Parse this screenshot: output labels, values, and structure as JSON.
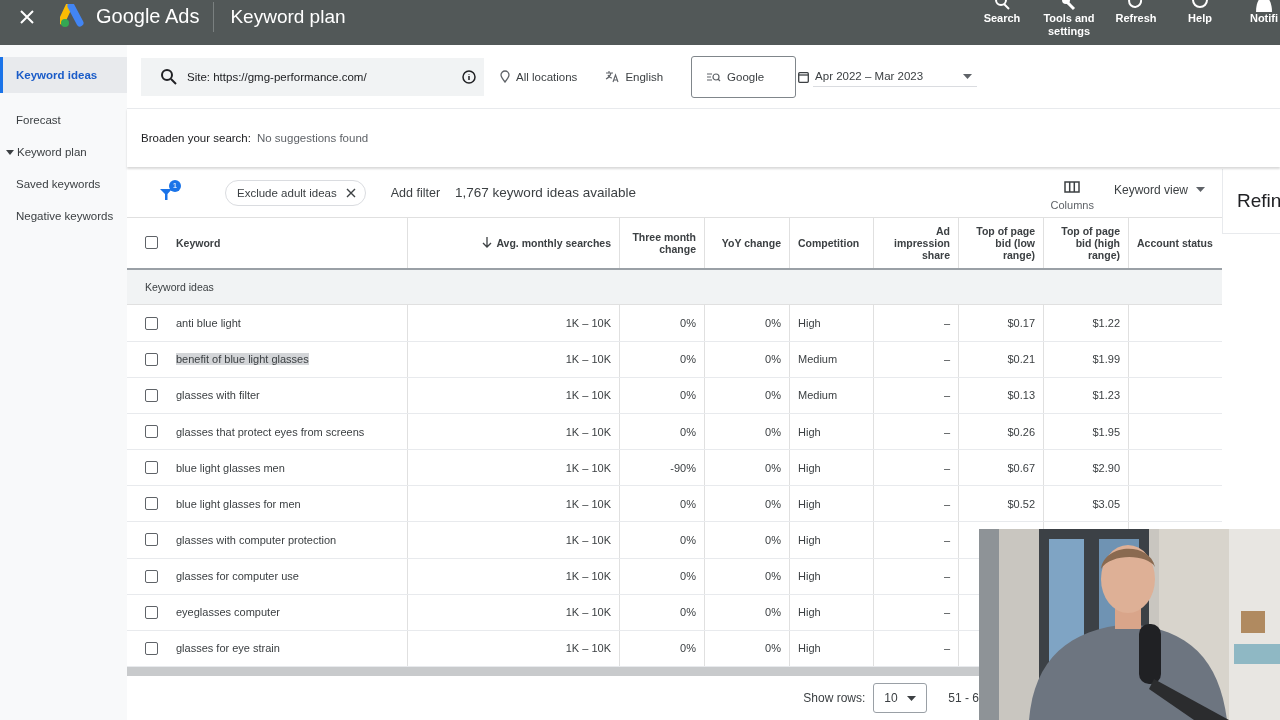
{
  "topbar": {
    "product": "Google Ads",
    "page_title": "Keyword plan",
    "actions": [
      {
        "kind": "search",
        "label": "Search"
      },
      {
        "kind": "tools",
        "label": "Tools and settings"
      },
      {
        "kind": "refresh",
        "label": "Refresh"
      },
      {
        "kind": "help",
        "label": "Help"
      },
      {
        "kind": "bell",
        "label": "Notifi"
      }
    ]
  },
  "sidebar": {
    "items": [
      {
        "label": "Keyword ideas",
        "kind": "link",
        "selected": true
      },
      {
        "label": "Forecast",
        "kind": "link",
        "selected": false
      },
      {
        "label": "Keyword plan",
        "kind": "group",
        "expanded": true,
        "selected": false
      },
      {
        "label": "Saved keywords",
        "kind": "link",
        "selected": false
      },
      {
        "label": "Negative keywords",
        "kind": "link",
        "selected": false
      }
    ]
  },
  "search": {
    "value": "Site: https://gmg-performance.com/",
    "location": "All locations",
    "language": "English",
    "network": "Google",
    "date_range": "Apr 2022 – Mar 2023"
  },
  "broaden": {
    "label": "Broaden your search:",
    "value": "No suggestions found"
  },
  "toolbar": {
    "filter_count": "1",
    "chip": "Exclude adult ideas",
    "add_filter": "Add filter",
    "summary": "1,767 keyword ideas available",
    "columns": "Columns",
    "view": "Keyword view"
  },
  "right_panel": {
    "title": "Refin"
  },
  "table": {
    "select_all_checked": false,
    "columns": [
      {
        "label": "Keyword",
        "sorted": false
      },
      {
        "label": "Avg. monthly searches",
        "sorted": true
      },
      {
        "label": "Three month change",
        "sorted": false
      },
      {
        "label": "YoY change",
        "sorted": false
      },
      {
        "label": "Competition",
        "sorted": false
      },
      {
        "label": "Ad impression share",
        "sorted": false
      },
      {
        "label": "Top of page bid (low range)",
        "sorted": false
      },
      {
        "label": "Top of page bid (high range)",
        "sorted": false
      },
      {
        "label": "Account status",
        "sorted": false
      }
    ],
    "group": "Keyword ideas",
    "rows": [
      {
        "checked": false,
        "highlighted": false,
        "cells": [
          "anti blue light",
          "1K – 10K",
          "0%",
          "0%",
          "High",
          "–",
          "$0.17",
          "$1.22"
        ]
      },
      {
        "checked": false,
        "highlighted": true,
        "cells": [
          "benefit of blue light glasses",
          "1K – 10K",
          "0%",
          "0%",
          "Medium",
          "–",
          "$0.21",
          "$1.99"
        ]
      },
      {
        "checked": false,
        "highlighted": false,
        "cells": [
          "glasses with filter",
          "1K – 10K",
          "0%",
          "0%",
          "Medium",
          "–",
          "$0.13",
          "$1.23"
        ]
      },
      {
        "checked": false,
        "highlighted": false,
        "cells": [
          "glasses that protect eyes from screens",
          "1K – 10K",
          "0%",
          "0%",
          "High",
          "–",
          "$0.26",
          "$1.95"
        ]
      },
      {
        "checked": false,
        "highlighted": false,
        "cells": [
          "blue light glasses men",
          "1K – 10K",
          "-90%",
          "0%",
          "High",
          "–",
          "$0.67",
          "$2.90"
        ]
      },
      {
        "checked": false,
        "highlighted": false,
        "cells": [
          "blue light glasses for men",
          "1K – 10K",
          "0%",
          "0%",
          "High",
          "–",
          "$0.52",
          "$3.05"
        ]
      },
      {
        "checked": false,
        "highlighted": false,
        "cells": [
          "glasses with computer protection",
          "1K – 10K",
          "0%",
          "0%",
          "High",
          "–"
        ]
      },
      {
        "checked": false,
        "highlighted": false,
        "cells": [
          "glasses for computer use",
          "1K – 10K",
          "0%",
          "0%",
          "High",
          "–"
        ]
      },
      {
        "checked": false,
        "highlighted": false,
        "cells": [
          "eyeglasses computer",
          "1K – 10K",
          "0%",
          "0%",
          "High",
          "–"
        ]
      },
      {
        "checked": false,
        "highlighted": false,
        "cells": [
          "glasses for eye strain",
          "1K – 10K",
          "0%",
          "0%",
          "High",
          "–"
        ]
      }
    ]
  },
  "footer": {
    "show_rows_label": "Show rows:",
    "rows_value": "10",
    "range": "51 - 6"
  }
}
